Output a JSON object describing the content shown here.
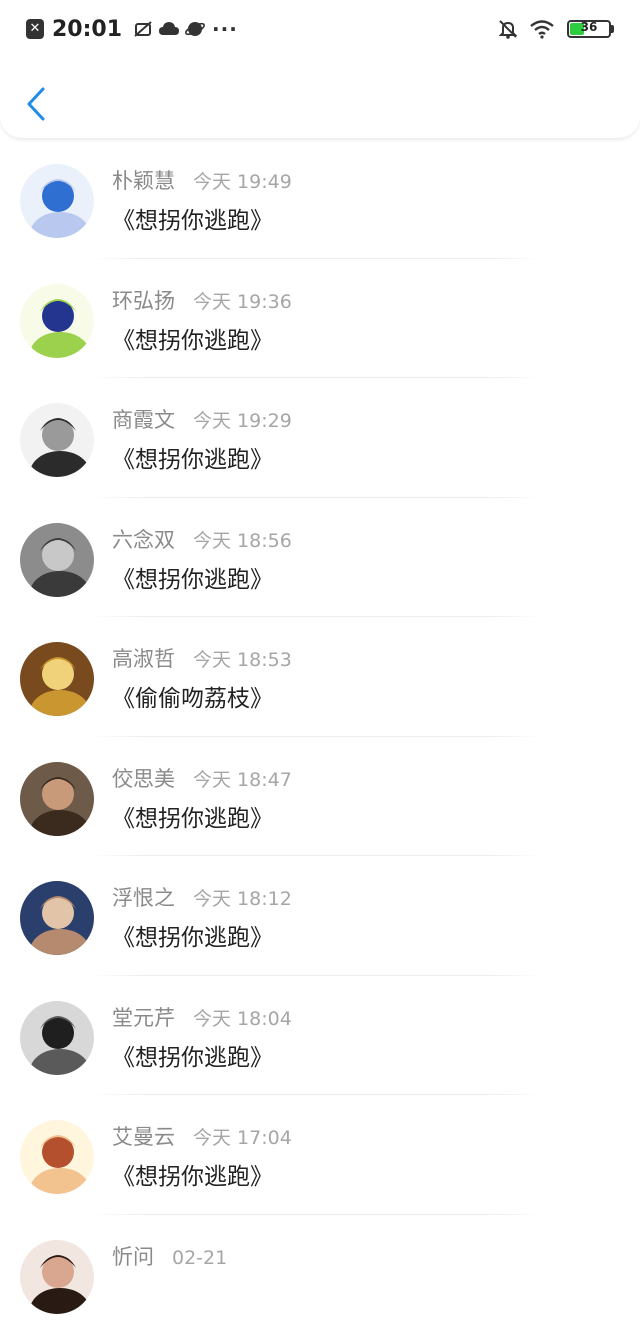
{
  "status_bar": {
    "time": "20:01",
    "battery": "36",
    "battery_level": 0.36,
    "icons": [
      "close-box-icon",
      "no-screenshot-icon",
      "cloud-icon",
      "planet-icon",
      "more-dots-icon",
      "bell-off-icon",
      "wifi-icon",
      "battery-icon"
    ]
  },
  "colors": {
    "accent": "#1e8ce8",
    "battery_green": "#2ecc40"
  },
  "messages": [
    {
      "name": "朴颖慧",
      "time": "今天 19:49",
      "text": "《想拐你逃跑》",
      "avatar": {
        "bg": "#eaf1fb",
        "fg": "#b9c8ee",
        "accent": "#2f6fd1"
      }
    },
    {
      "name": "环弘扬",
      "time": "今天 19:36",
      "text": "《想拐你逃跑》",
      "avatar": {
        "bg": "#f7fbe8",
        "fg": "#9bd14d",
        "accent": "#23358f"
      }
    },
    {
      "name": "商霞文",
      "time": "今天 19:29",
      "text": "《想拐你逃跑》",
      "avatar": {
        "bg": "#f2f2f2",
        "fg": "#2b2b2b",
        "accent": "#9a9a9a"
      }
    },
    {
      "name": "六念双",
      "time": "今天 18:56",
      "text": "《想拐你逃跑》",
      "avatar": {
        "bg": "#8c8c8c",
        "fg": "#3a3a3a",
        "accent": "#c8c8c8"
      }
    },
    {
      "name": "高淑哲",
      "time": "今天 18:53",
      "text": "《偷偷吻荔枝》",
      "avatar": {
        "bg": "#7a4a1f",
        "fg": "#c9962f",
        "accent": "#f0d27a"
      }
    },
    {
      "name": "佼思美",
      "time": "今天 18:47",
      "text": "《想拐你逃跑》",
      "avatar": {
        "bg": "#6d5a48",
        "fg": "#3b2a1e",
        "accent": "#c89a7a"
      }
    },
    {
      "name": "浮恨之",
      "time": "今天 18:12",
      "text": "《想拐你逃跑》",
      "avatar": {
        "bg": "#2a3f6b",
        "fg": "#b58a6e",
        "accent": "#e2c4a8"
      }
    },
    {
      "name": "堂元芹",
      "time": "今天 18:04",
      "text": "《想拐你逃跑》",
      "avatar": {
        "bg": "#d8d8d8",
        "fg": "#5a5a5a",
        "accent": "#1f1f1f"
      }
    },
    {
      "name": "艾曼云",
      "time": "今天 17:04",
      "text": "《想拐你逃跑》",
      "avatar": {
        "bg": "#fff6dd",
        "fg": "#f2c28f",
        "accent": "#b5502e"
      }
    },
    {
      "name": "忻问",
      "time": "02-21",
      "text": "",
      "avatar": {
        "bg": "#f1e6e0",
        "fg": "#2a1a14",
        "accent": "#d9a690"
      }
    }
  ]
}
